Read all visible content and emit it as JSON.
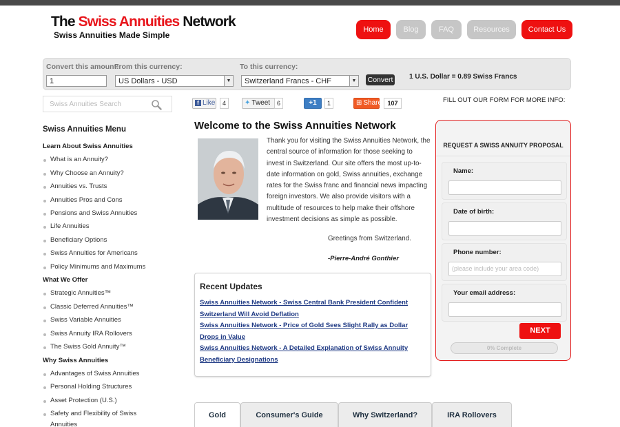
{
  "header": {
    "title_prefix": "The ",
    "title_red": "Swiss Annuities",
    "title_suffix": " Network",
    "tagline": "Swiss Annuities Made Simple",
    "nav": [
      {
        "label": "Home"
      },
      {
        "label": "Blog"
      },
      {
        "label": "FAQ"
      },
      {
        "label": "Resources"
      },
      {
        "label": "Contact Us"
      }
    ]
  },
  "converter": {
    "amount_label": "Convert this amount:",
    "amount_value": "1",
    "from_label": "From this currency:",
    "from_value": "US Dollars - USD",
    "to_label": "To this currency:",
    "to_value": "Switzerland Francs - CHF",
    "convert_label": "Convert",
    "rate_text": "1 U.S. Dollar = 0.89 Swiss Francs"
  },
  "search": {
    "placeholder": "Swiss Annuities Search"
  },
  "social": {
    "like_label": "Like",
    "like_count": "4",
    "tweet_label": "Tweet",
    "tweet_count": "6",
    "plusone_label": "+1",
    "plusone_count": "1",
    "share_label": "Share",
    "share_count": "107"
  },
  "fill_out_text": "FILL OUT OUR FORM FOR MORE INFO:",
  "sidebar": {
    "title": "Swiss Annuities Menu",
    "sections": [
      {
        "heading": "Learn About Swiss Annuities",
        "items": [
          "What is an Annuity?",
          "Why Choose an Annuity?",
          "Annuities vs. Trusts",
          "Annuities Pros and Cons",
          "Pensions and Swiss Annuities",
          "Life Annuities",
          "Beneficiary Options",
          "Swiss Annuities for Americans",
          "Policy Minimums and Maximums"
        ]
      },
      {
        "heading": "What We Offer",
        "items": [
          "Strategic Annuities™",
          "Classic Deferred Annuities™",
          "Swiss Variable Annuities",
          "Swiss Annuity IRA Rollovers",
          "The Swiss Gold Annuity™"
        ]
      },
      {
        "heading": "Why Swiss Annuities",
        "items": [
          "Advantages of Swiss Annuities",
          "Personal Holding Structures",
          "Asset Protection (U.S.)",
          "Safety and Flexibility of Swiss",
          "Annuities"
        ]
      }
    ]
  },
  "main": {
    "title": "Welcome to the Swiss Annuities Network",
    "intro": "Thank you for visiting the Swiss Annuities Network, the central source of information for those seeking to invest in Switzerland.  Our site offers the most up-to-date information on gold, Swiss annuities, exchange rates for the Swiss franc and financial news impacting foreign investors.  We also provide visitors with a multitude of resources to help make their offshore investment decisions as simple as possible.",
    "greeting": "Greetings from Switzerland.",
    "signature": "-Pierre-André Gonthier",
    "updates_title": "Recent Updates",
    "updates": [
      "Swiss Annuities Network - Swiss Central Bank President Confident Switzerland Will Avoid Deflation",
      "Swiss Annuities Network - Price of Gold Sees Slight Rally as Dollar Drops in Value",
      "Swiss Annuities Network - A Detailed Explanation of Swiss Annuity Beneficiary Designations"
    ],
    "tabs": [
      "Gold",
      "Consumer's Guide",
      "Why Switzerland?",
      "IRA Rollovers"
    ]
  },
  "form": {
    "title": "REQUEST A SWISS ANNUITY PROPOSAL",
    "name_label": "Name:",
    "dob_label": "Date of birth:",
    "phone_label": "Phone number:",
    "phone_placeholder": "(please include your area code)",
    "email_label": "Your email address:",
    "next_label": "NEXT",
    "progress_text": "0% Complete",
    "progress_value": 0
  },
  "colors": {
    "accent": "#ee1111",
    "link": "#1f3a84",
    "disabled_nav": "#c6c6c6"
  }
}
